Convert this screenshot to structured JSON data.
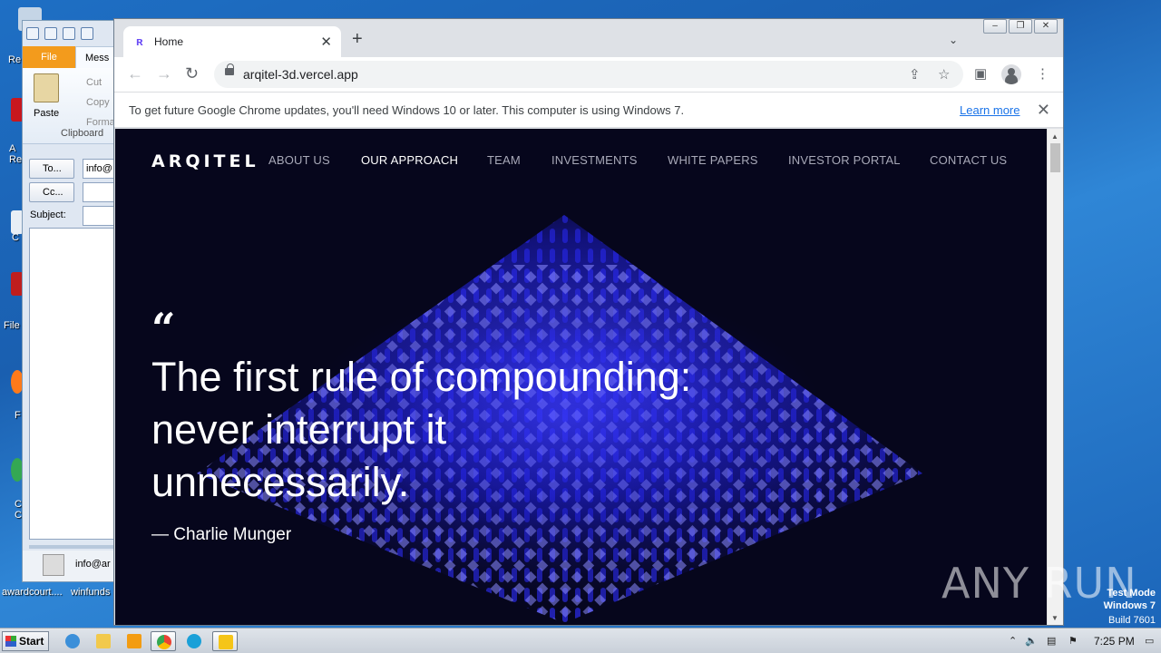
{
  "desktop": {
    "icons": [
      {
        "label": "Re"
      },
      {
        "label": "A Re"
      },
      {
        "label": "C"
      },
      {
        "label": "File"
      },
      {
        "label": "F"
      },
      {
        "label": "C C"
      }
    ],
    "bottom_labels": [
      "awardcourt....",
      "winfunds"
    ]
  },
  "outlook": {
    "tabs": {
      "file": "File",
      "message": "Mess"
    },
    "ribbon": {
      "paste": "Paste",
      "cut": "Cut",
      "copy": "Copy",
      "format": "Forma",
      "group": "Clipboard"
    },
    "fields": {
      "to_button": "To...",
      "to_value": "info@",
      "cc_button": "Cc...",
      "subject_label": "Subject:"
    },
    "people_pane": "info@ar"
  },
  "chrome": {
    "tab_title": "Home",
    "url": "arqitel-3d.vercel.app",
    "infobar_text": "To get future Google Chrome updates, you'll need Windows 10 or later. This computer is using Windows 7.",
    "learn_more": "Learn more"
  },
  "page": {
    "logo": "ARQITEL",
    "nav": [
      "ABOUT US",
      "OUR APPROACH",
      "TEAM",
      "INVESTMENTS",
      "WHITE PAPERS",
      "INVESTOR PORTAL",
      "CONTACT US"
    ],
    "active_nav": "OUR APPROACH",
    "quote_mark": "“",
    "quote": "The first rule of compounding: never interrupt it unnecessarily.",
    "author": "— Charlie Munger",
    "colors": {
      "background": "#06061c",
      "accent": "#2a2aff"
    }
  },
  "taskbar": {
    "start": "Start",
    "time": "7:25 PM"
  },
  "watermark": {
    "brand": "ANY RUN",
    "test_mode": "Test Mode",
    "os": "Windows 7",
    "build": "Build 7601"
  }
}
